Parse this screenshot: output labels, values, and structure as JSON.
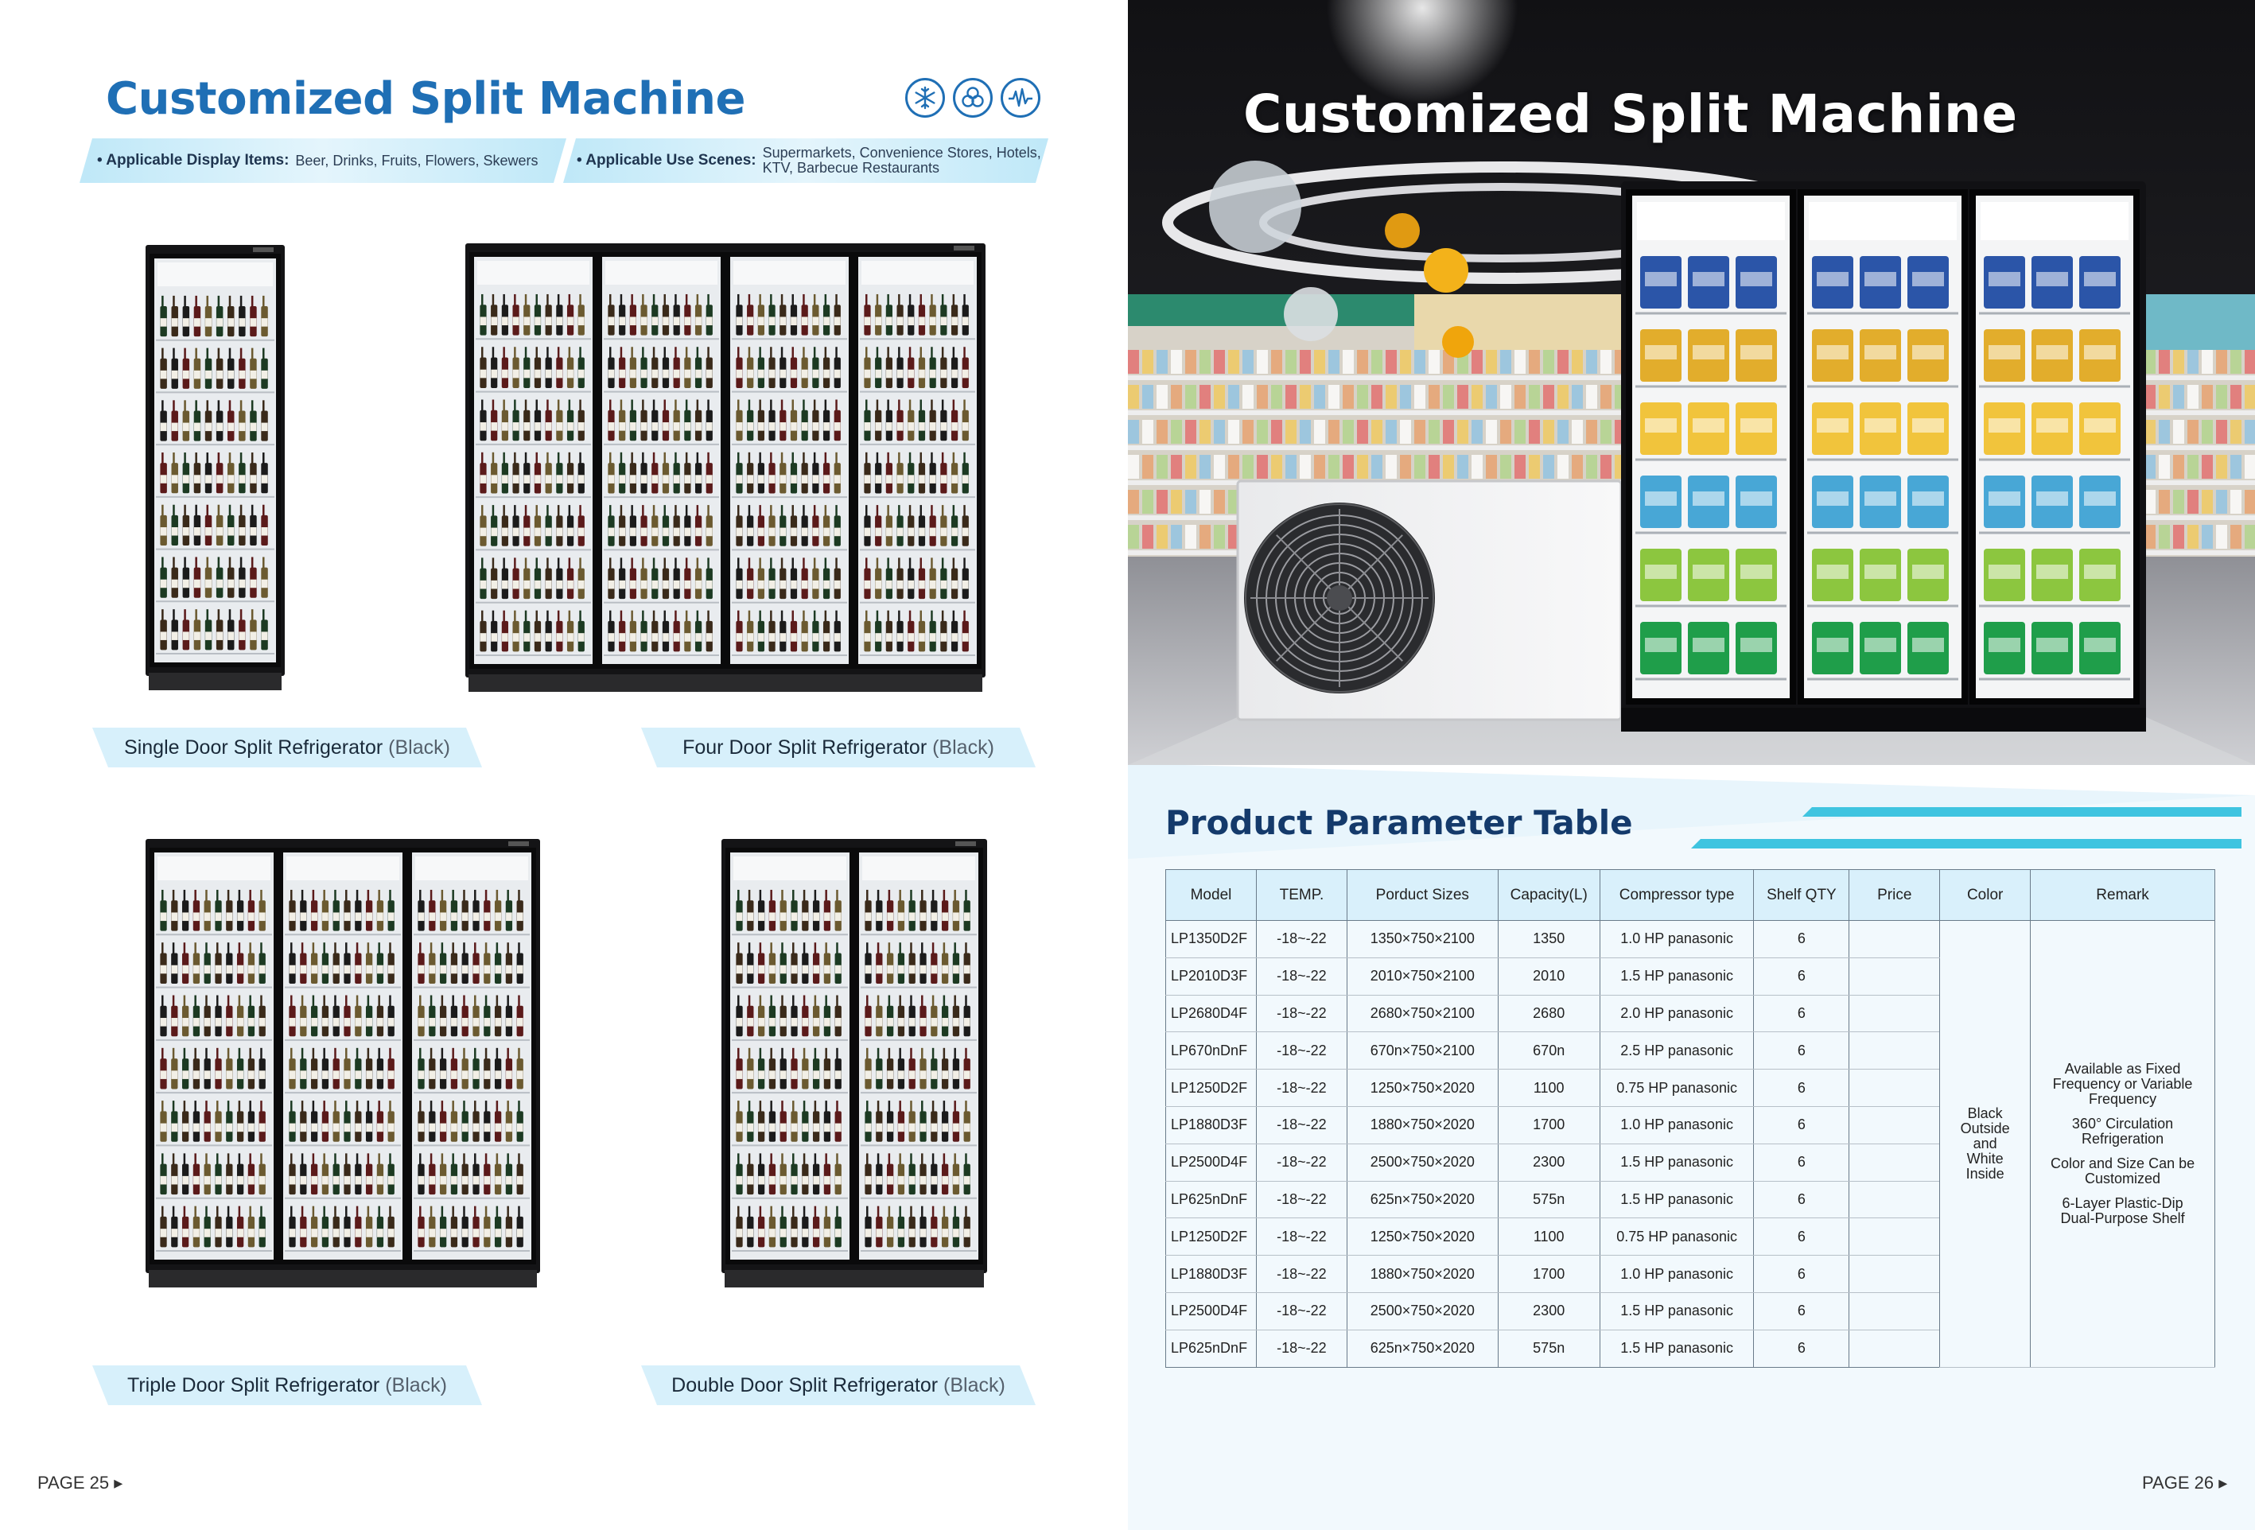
{
  "left": {
    "title": "Customized Split Machine",
    "icons": [
      "snowflake-icon",
      "circulation-icon",
      "wave-icon"
    ],
    "banner": {
      "display_label": "• Applicable Display Items:",
      "display_value": "Beer, Drinks, Fruits, Flowers, Skewers",
      "scenes_label": "• Applicable Use Scenes:",
      "scenes_value": "Supermarkets, Convenience Stores, Hotels, KTV, Barbecue Restaurants"
    },
    "products": [
      {
        "name": "Single Door Split Refrigerator",
        "color": "(Black)"
      },
      {
        "name": "Four Door Split Refrigerator",
        "color": "(Black)"
      },
      {
        "name": "Triple Door Split Refrigerator",
        "color": "(Black)"
      },
      {
        "name": "Double Door Split Refrigerator",
        "color": "(Black)"
      }
    ],
    "page_number": "PAGE 25 ▸"
  },
  "right": {
    "hero_title": "Customized Split Machine",
    "table_title": "Product Parameter Table",
    "table": {
      "headers": [
        "Model",
        "TEMP.",
        "Porduct Sizes",
        "Capacity(L)",
        "Compressor type",
        "Shelf QTY",
        "Price",
        "Color",
        "Remark"
      ],
      "rows": [
        [
          "LP1350D2F",
          "-18~-22",
          "1350×750×2100",
          "1350",
          "1.0 HP panasonic",
          "6"
        ],
        [
          "LP2010D3F",
          "-18~-22",
          "2010×750×2100",
          "2010",
          "1.5 HP panasonic",
          "6"
        ],
        [
          "LP2680D4F",
          "-18~-22",
          "2680×750×2100",
          "2680",
          "2.0 HP panasonic",
          "6"
        ],
        [
          "LP670nDnF",
          "-18~-22",
          "670n×750×2100",
          "670n",
          "2.5 HP panasonic",
          "6"
        ],
        [
          "LP1250D2F",
          "-18~-22",
          "1250×750×2020",
          "1100",
          "0.75 HP panasonic",
          "6"
        ],
        [
          "LP1880D3F",
          "-18~-22",
          "1880×750×2020",
          "1700",
          "1.0 HP panasonic",
          "6"
        ],
        [
          "LP2500D4F",
          "-18~-22",
          "2500×750×2020",
          "2300",
          "1.5 HP panasonic",
          "6"
        ],
        [
          "LP625nDnF",
          "-18~-22",
          "625n×750×2020",
          "575n",
          "1.5 HP panasonic",
          "6"
        ],
        [
          "LP1250D2F",
          "-18~-22",
          "1250×750×2020",
          "1100",
          "0.75 HP panasonic",
          "6"
        ],
        [
          "LP1880D3F",
          "-18~-22",
          "1880×750×2020",
          "1700",
          "1.0 HP panasonic",
          "6"
        ],
        [
          "LP2500D4F",
          "-18~-22",
          "2500×750×2020",
          "2300",
          "1.5 HP panasonic",
          "6"
        ],
        [
          "LP625nDnF",
          "-18~-22",
          "625n×750×2020",
          "575n",
          "1.5 HP panasonic",
          "6"
        ]
      ],
      "color_value": "Black Outside and White Inside",
      "remarks": [
        "Available as Fixed Frequency or Variable Frequency",
        "360° Circulation Refrigeration",
        "Color and Size Can be Customized",
        "6-Layer Plastic-Dip Dual-Purpose Shelf"
      ]
    },
    "page_number": "PAGE 26 ▸"
  },
  "colors": {
    "title_blue": "#1f6fb5",
    "navy": "#143a6b",
    "light_blue": "#d9f0fb",
    "accent_cyan": "#3fc4e0"
  }
}
